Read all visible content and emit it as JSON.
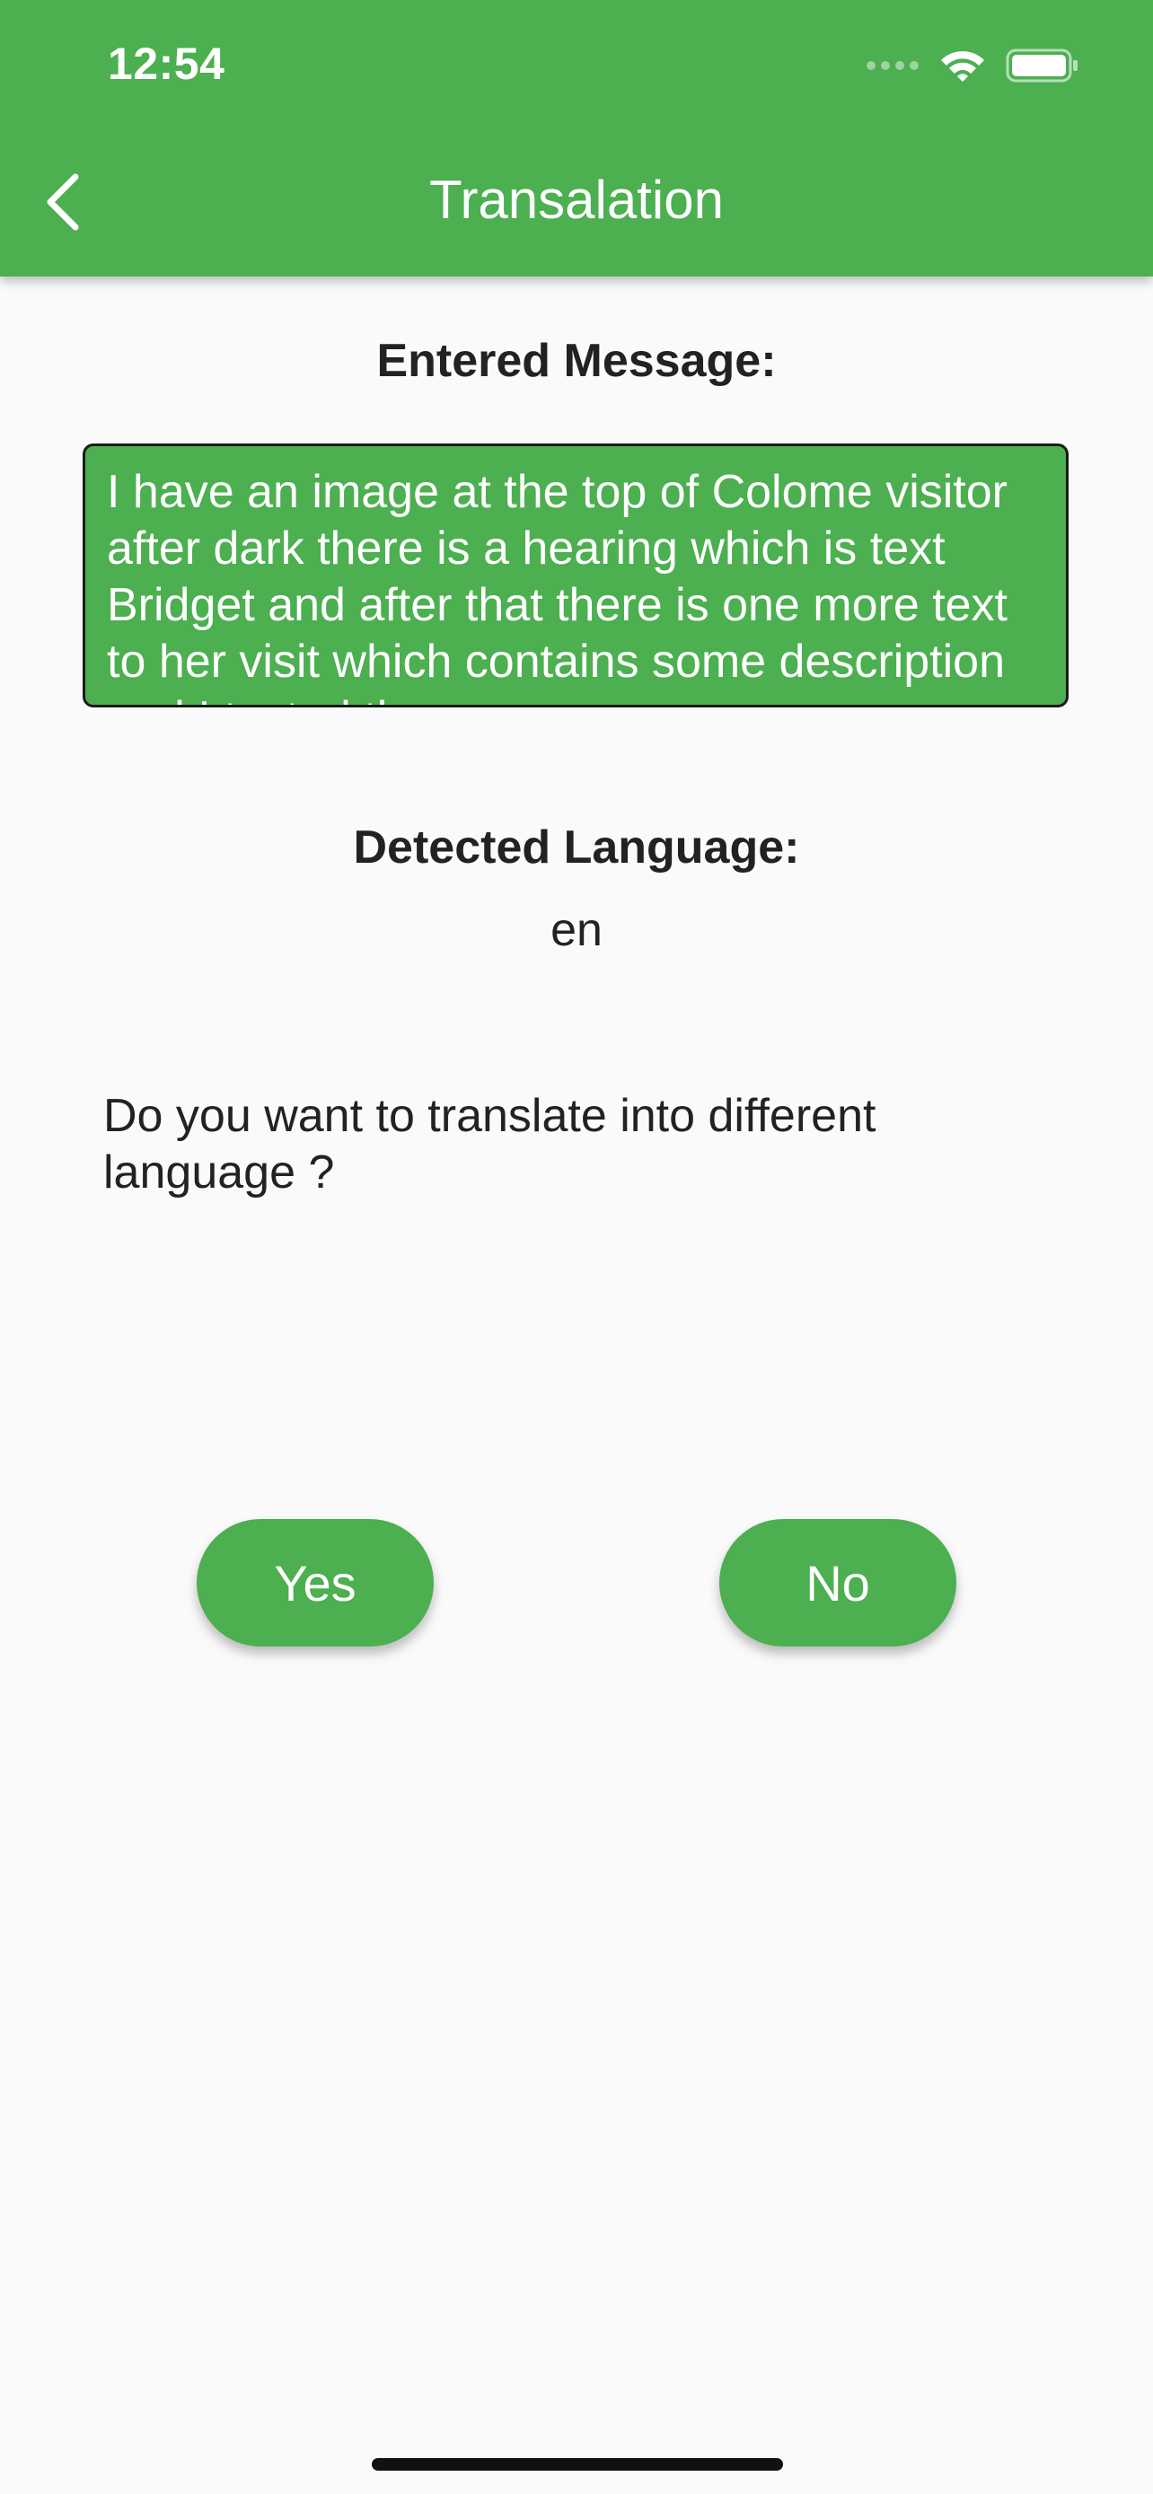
{
  "status_bar": {
    "time": "12:54",
    "icons": [
      "signal-icon",
      "wifi-icon",
      "battery-icon"
    ]
  },
  "app_bar": {
    "title": "Transalation",
    "back_icon": "chevron-left-icon",
    "color": "#4caf50"
  },
  "entered": {
    "label": "Entered Message:",
    "message": "I have an image at the top of Colome visitor after dark there is a hearing which is text Bridget and after that there is one more text to her visit which contains some description and I tested those"
  },
  "detected": {
    "label": "Detected Language:",
    "value": "en"
  },
  "question": "Do you want to translate into different language ?",
  "buttons": {
    "yes": "Yes",
    "no": "No"
  }
}
